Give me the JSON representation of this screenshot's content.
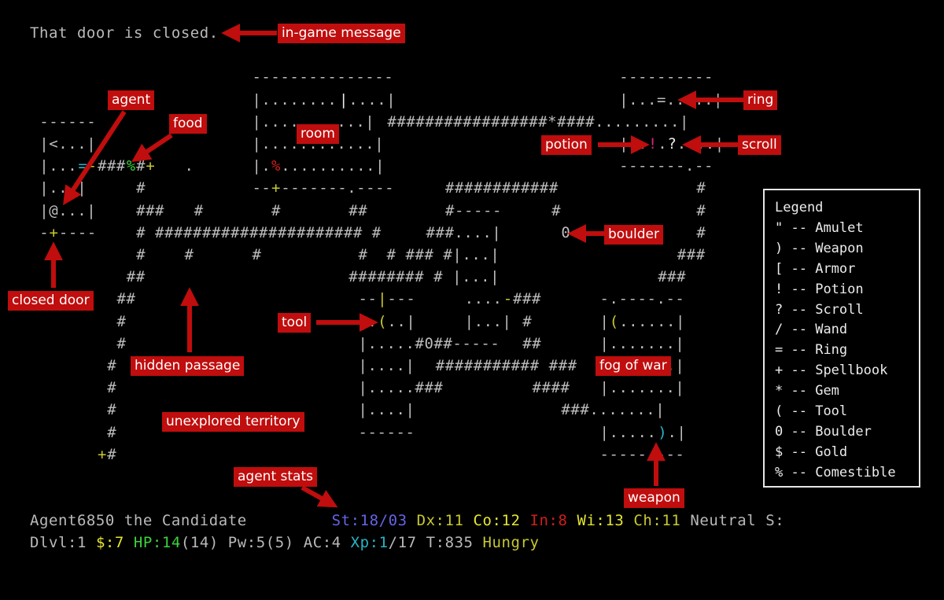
{
  "message": "That door is closed.",
  "map_rows": [
    {
      "row": 2,
      "segments": [
        {
          "col": 23,
          "text": "---------------"
        },
        {
          "col": 61,
          "text": "----------"
        }
      ]
    },
    {
      "row": 3,
      "segments": [
        {
          "col": 23,
          "text": "|........"
        },
        {
          "col": 32,
          "text": "|",
          "color": "white"
        },
        {
          "col": 33,
          "text": "....|"
        },
        {
          "col": 61,
          "text": "|...=.....|"
        }
      ]
    },
    {
      "row": 4,
      "segments": [
        {
          "col": 1,
          "text": "------"
        },
        {
          "col": 23,
          "text": "|...........|"
        },
        {
          "col": 37,
          "text": "#################*####.........|"
        }
      ]
    },
    {
      "row": 5,
      "segments": [
        {
          "col": 1,
          "text": "|<...|"
        },
        {
          "col": 23,
          "text": "|............|"
        },
        {
          "col": 61,
          "text": "|.."
        },
        {
          "col": 64,
          "text": "!",
          "color": "magenta"
        },
        {
          "col": 65,
          "text": "."
        },
        {
          "col": 66,
          "text": "?",
          "color": "white"
        },
        {
          "col": 67,
          "text": "....|"
        }
      ]
    },
    {
      "row": 6,
      "segments": [
        {
          "col": 1,
          "text": "|..."
        },
        {
          "col": 5,
          "text": "=",
          "color": "cyan"
        },
        {
          "col": 6,
          "text": "-",
          "color": "yellow"
        },
        {
          "col": 7,
          "text": "###"
        },
        {
          "col": 10,
          "text": "%",
          "color": "green"
        },
        {
          "col": 11,
          "text": "#"
        },
        {
          "col": 12,
          "text": "+",
          "color": "yellow"
        },
        {
          "col": 16,
          "text": "."
        },
        {
          "col": 23,
          "text": "|."
        },
        {
          "col": 25,
          "text": "%",
          "color": "red"
        },
        {
          "col": 26,
          "text": "..........|"
        },
        {
          "col": 61,
          "text": "-------.--"
        }
      ]
    },
    {
      "row": 7,
      "segments": [
        {
          "col": 1,
          "text": "|...|"
        },
        {
          "col": 11,
          "text": "#"
        },
        {
          "col": 23,
          "text": "--"
        },
        {
          "col": 25,
          "text": "+",
          "color": "yellow"
        },
        {
          "col": 26,
          "text": "-------.----"
        },
        {
          "col": 43,
          "text": "############"
        },
        {
          "col": 69,
          "text": "#"
        }
      ]
    },
    {
      "row": 8,
      "segments": [
        {
          "col": 1,
          "text": "|@...|"
        },
        {
          "col": 11,
          "text": "###"
        },
        {
          "col": 17,
          "text": "#"
        },
        {
          "col": 25,
          "text": "#"
        },
        {
          "col": 33,
          "text": "##"
        },
        {
          "col": 43,
          "text": "#-----"
        },
        {
          "col": 54,
          "text": "#"
        },
        {
          "col": 69,
          "text": "#"
        }
      ]
    },
    {
      "row": 9,
      "segments": [
        {
          "col": 1,
          "text": "-"
        },
        {
          "col": 2,
          "text": "+",
          "color": "yellow"
        },
        {
          "col": 3,
          "text": "----"
        },
        {
          "col": 11,
          "text": "# ###################### #"
        },
        {
          "col": 41,
          "text": "###....|"
        },
        {
          "col": 55,
          "text": "0"
        },
        {
          "col": 69,
          "text": "#"
        }
      ]
    },
    {
      "row": 10,
      "segments": [
        {
          "col": 11,
          "text": "#"
        },
        {
          "col": 16,
          "text": "#"
        },
        {
          "col": 23,
          "text": "#"
        },
        {
          "col": 34,
          "text": "#  # ### #|...|"
        },
        {
          "col": 67,
          "text": "###"
        }
      ]
    },
    {
      "row": 11,
      "segments": [
        {
          "col": 10,
          "text": "##"
        },
        {
          "col": 33,
          "text": "######## # |...|"
        },
        {
          "col": 65,
          "text": "###"
        }
      ]
    },
    {
      "row": 12,
      "segments": [
        {
          "col": 9,
          "text": "##"
        },
        {
          "col": 34,
          "text": "--"
        },
        {
          "col": 36,
          "text": "|",
          "color": "yellow"
        },
        {
          "col": 37,
          "text": "---"
        },
        {
          "col": 45,
          "text": "...."
        },
        {
          "col": 49,
          "text": "-",
          "color": "yellow"
        },
        {
          "col": 50,
          "text": "###"
        },
        {
          "col": 59,
          "text": "-.----.--"
        }
      ]
    },
    {
      "row": 13,
      "segments": [
        {
          "col": 9,
          "text": "#"
        },
        {
          "col": 34,
          "text": "|."
        },
        {
          "col": 36,
          "text": "(",
          "color": "yellow"
        },
        {
          "col": 37,
          "text": "..|"
        },
        {
          "col": 45,
          "text": "|...|"
        },
        {
          "col": 51,
          "text": "#"
        },
        {
          "col": 59,
          "text": "|"
        },
        {
          "col": 60,
          "text": "(",
          "color": "yellow"
        },
        {
          "col": 61,
          "text": "......|"
        }
      ]
    },
    {
      "row": 14,
      "segments": [
        {
          "col": 9,
          "text": "#"
        },
        {
          "col": 34,
          "text": "|.....#0##-----"
        },
        {
          "col": 51,
          "text": "##"
        },
        {
          "col": 59,
          "text": "|.......|"
        }
      ]
    },
    {
      "row": 15,
      "segments": [
        {
          "col": 8,
          "text": "#"
        },
        {
          "col": 34,
          "text": "|....|"
        },
        {
          "col": 42,
          "text": "########### ###"
        },
        {
          "col": 59,
          "text": "|.......|"
        }
      ]
    },
    {
      "row": 16,
      "segments": [
        {
          "col": 8,
          "text": "#"
        },
        {
          "col": 34,
          "text": "|.....###"
        },
        {
          "col": 52,
          "text": "####"
        },
        {
          "col": 59,
          "text": "|.......|"
        }
      ]
    },
    {
      "row": 17,
      "segments": [
        {
          "col": 8,
          "text": "#"
        },
        {
          "col": 34,
          "text": "|....|"
        },
        {
          "col": 55,
          "text": "###.......|"
        }
      ]
    },
    {
      "row": 18,
      "segments": [
        {
          "col": 8,
          "text": "#"
        },
        {
          "col": 34,
          "text": "------"
        },
        {
          "col": 59,
          "text": "|....."
        },
        {
          "col": 65,
          "text": ")",
          "color": "cyan"
        },
        {
          "col": 66,
          "text": ".|"
        }
      ]
    },
    {
      "row": 19,
      "segments": [
        {
          "col": 7,
          "text": "+",
          "color": "yellow"
        },
        {
          "col": 8,
          "text": "#"
        },
        {
          "col": 59,
          "text": "---------"
        }
      ]
    }
  ],
  "status": {
    "line1": [
      {
        "text": "Agent6850 the Candidate         "
      },
      {
        "text": "St:18/03",
        "color": "blue"
      },
      {
        "text": " "
      },
      {
        "text": "Dx:11",
        "color": "yellow"
      },
      {
        "text": " "
      },
      {
        "text": "Co:12",
        "color": "bright-yellow"
      },
      {
        "text": " "
      },
      {
        "text": "In:8",
        "color": "red"
      },
      {
        "text": " "
      },
      {
        "text": "Wi:13",
        "color": "bright-yellow"
      },
      {
        "text": " "
      },
      {
        "text": "Ch:11",
        "color": "yellow"
      },
      {
        "text": " Neutral S:"
      }
    ],
    "line2": [
      {
        "text": "Dlvl:1 "
      },
      {
        "text": "$:7",
        "color": "bright-yellow"
      },
      {
        "text": " "
      },
      {
        "text": "HP:14",
        "color": "green"
      },
      {
        "text": "(14) Pw:5(5) AC:4 "
      },
      {
        "text": "Xp:1",
        "color": "cyan"
      },
      {
        "text": "/17 T:835 "
      },
      {
        "text": "Hungry",
        "color": "yellow"
      }
    ]
  },
  "legend": {
    "title": "Legend",
    "items": [
      {
        "symbol": "\"",
        "name": "Amulet"
      },
      {
        "symbol": ")",
        "name": "Weapon"
      },
      {
        "symbol": "[",
        "name": "Armor"
      },
      {
        "symbol": "!",
        "name": "Potion"
      },
      {
        "symbol": "?",
        "name": "Scroll"
      },
      {
        "symbol": "/",
        "name": "Wand"
      },
      {
        "symbol": "=",
        "name": "Ring"
      },
      {
        "symbol": "+",
        "name": "Spellbook"
      },
      {
        "symbol": "*",
        "name": "Gem"
      },
      {
        "symbol": "(",
        "name": "Tool"
      },
      {
        "symbol": "0",
        "name": "Boulder"
      },
      {
        "symbol": "$",
        "name": "Gold"
      },
      {
        "symbol": "%",
        "name": "Comestible"
      }
    ]
  },
  "annotations": {
    "in_game_message": "in-game message",
    "agent": "agent",
    "food": "food",
    "room": "room",
    "ring": "ring",
    "potion": "potion",
    "scroll": "scroll",
    "boulder": "boulder",
    "closed_door": "closed door",
    "tool": "tool",
    "hidden_passage": "hidden passage",
    "fog_of_war": "fog of war",
    "unexplored_territory": "unexplored territory",
    "agent_stats": "agent stats",
    "weapon": "weapon"
  },
  "colors": {
    "annotation": "#c00d0d",
    "white": "#ececec",
    "yellow": "#c8c832",
    "bright-yellow": "#e6e632",
    "green": "#3cd23c",
    "cyan": "#28b4c8",
    "red": "#d01e1e",
    "magenta": "#d0287c",
    "blue": "#6464e6"
  }
}
